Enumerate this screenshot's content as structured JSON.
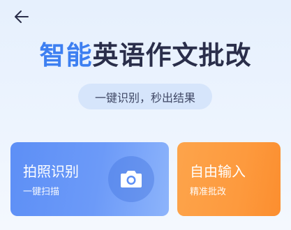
{
  "header": {
    "back_icon": "back-arrow-icon"
  },
  "hero": {
    "title_accent": "智能",
    "title_rest": "英语作文批改",
    "subtitle": "一键识别，秒出结果"
  },
  "cards": {
    "photo": {
      "title": "拍照识别",
      "subtitle": "一键扫描",
      "icon": "camera-icon",
      "color": "#5d8ff6"
    },
    "input": {
      "title": "自由输入",
      "subtitle": "精准批改",
      "color": "#fda44b"
    }
  },
  "colors": {
    "accent": "#3d7ff1",
    "title_dark": "#2a2e4a",
    "pill_bg": "#d6e5fb"
  }
}
